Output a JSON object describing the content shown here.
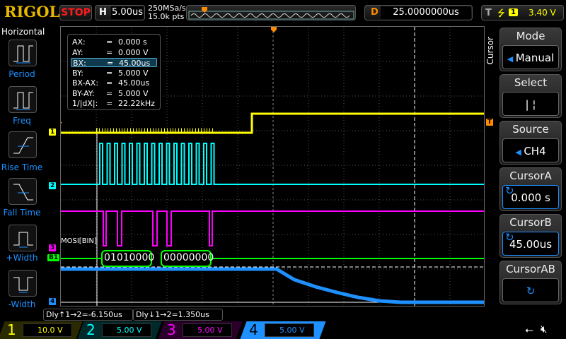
{
  "header": {
    "logo": "RIGOL",
    "run_state": "STOP",
    "h_label": "H",
    "timebase": "5.00us",
    "sample_rate": "250MSa/s",
    "memory_depth": "15.0k pts",
    "d_label": "D",
    "delay": "25.0000000us",
    "t_label": "T",
    "trigger_source": "1",
    "trigger_level": "3.40 V"
  },
  "left_panel": {
    "title": "Horizontal",
    "items": [
      {
        "label": "Period"
      },
      {
        "label": "Freq"
      },
      {
        "label": "Rise Time"
      },
      {
        "label": "Fall Time"
      },
      {
        "label": "+Width"
      },
      {
        "label": "-Width"
      }
    ]
  },
  "cursor_info": {
    "rows": [
      {
        "k": "AX:",
        "v": "0.000 s"
      },
      {
        "k": "AY:",
        "v": "0.000 V"
      },
      {
        "k": "BX:",
        "v": "45.00us"
      },
      {
        "k": "BY:",
        "v": "5.000 V"
      },
      {
        "k": "BX-AX:",
        "v": "45.00us"
      },
      {
        "k": "BY-AY:",
        "v": "5.000 V"
      },
      {
        "k": "1/|dX|:",
        "v": "22.22kHz"
      }
    ],
    "eq": "="
  },
  "bus": {
    "label": "MOSI[BIN]",
    "frames": [
      "01010000",
      "00000000"
    ]
  },
  "markers": {
    "ch1": "1",
    "ch2": "2",
    "ch3": "3",
    "bus": "B1",
    "ch4": "4",
    "trig": "T"
  },
  "right_menu": {
    "title": "Cursor",
    "mode_label": "Mode",
    "mode_value": "Manual",
    "select_label": "Select",
    "select_value": "|  ¦",
    "source_label": "Source",
    "source_value": "CH4",
    "cursor_a_label": "CursorA",
    "cursor_a_value": "0.000 s",
    "cursor_b_label": "CursorB",
    "cursor_b_value": "45.00us",
    "cursor_ab_label": "CursorAB"
  },
  "delay_readouts": [
    "Dly↑1→2=-6.150us",
    "Dly↓1→2=1.350us"
  ],
  "channels": [
    {
      "n": "1",
      "scale": "10.0 V",
      "color": "#ffff00"
    },
    {
      "n": "2",
      "scale": "5.00 V",
      "color": "#00ffff"
    },
    {
      "n": "3",
      "scale": "5.00 V",
      "color": "#ff00ff"
    },
    {
      "n": "4",
      "scale": "5.00 V",
      "color": "#1e90ff"
    }
  ]
}
